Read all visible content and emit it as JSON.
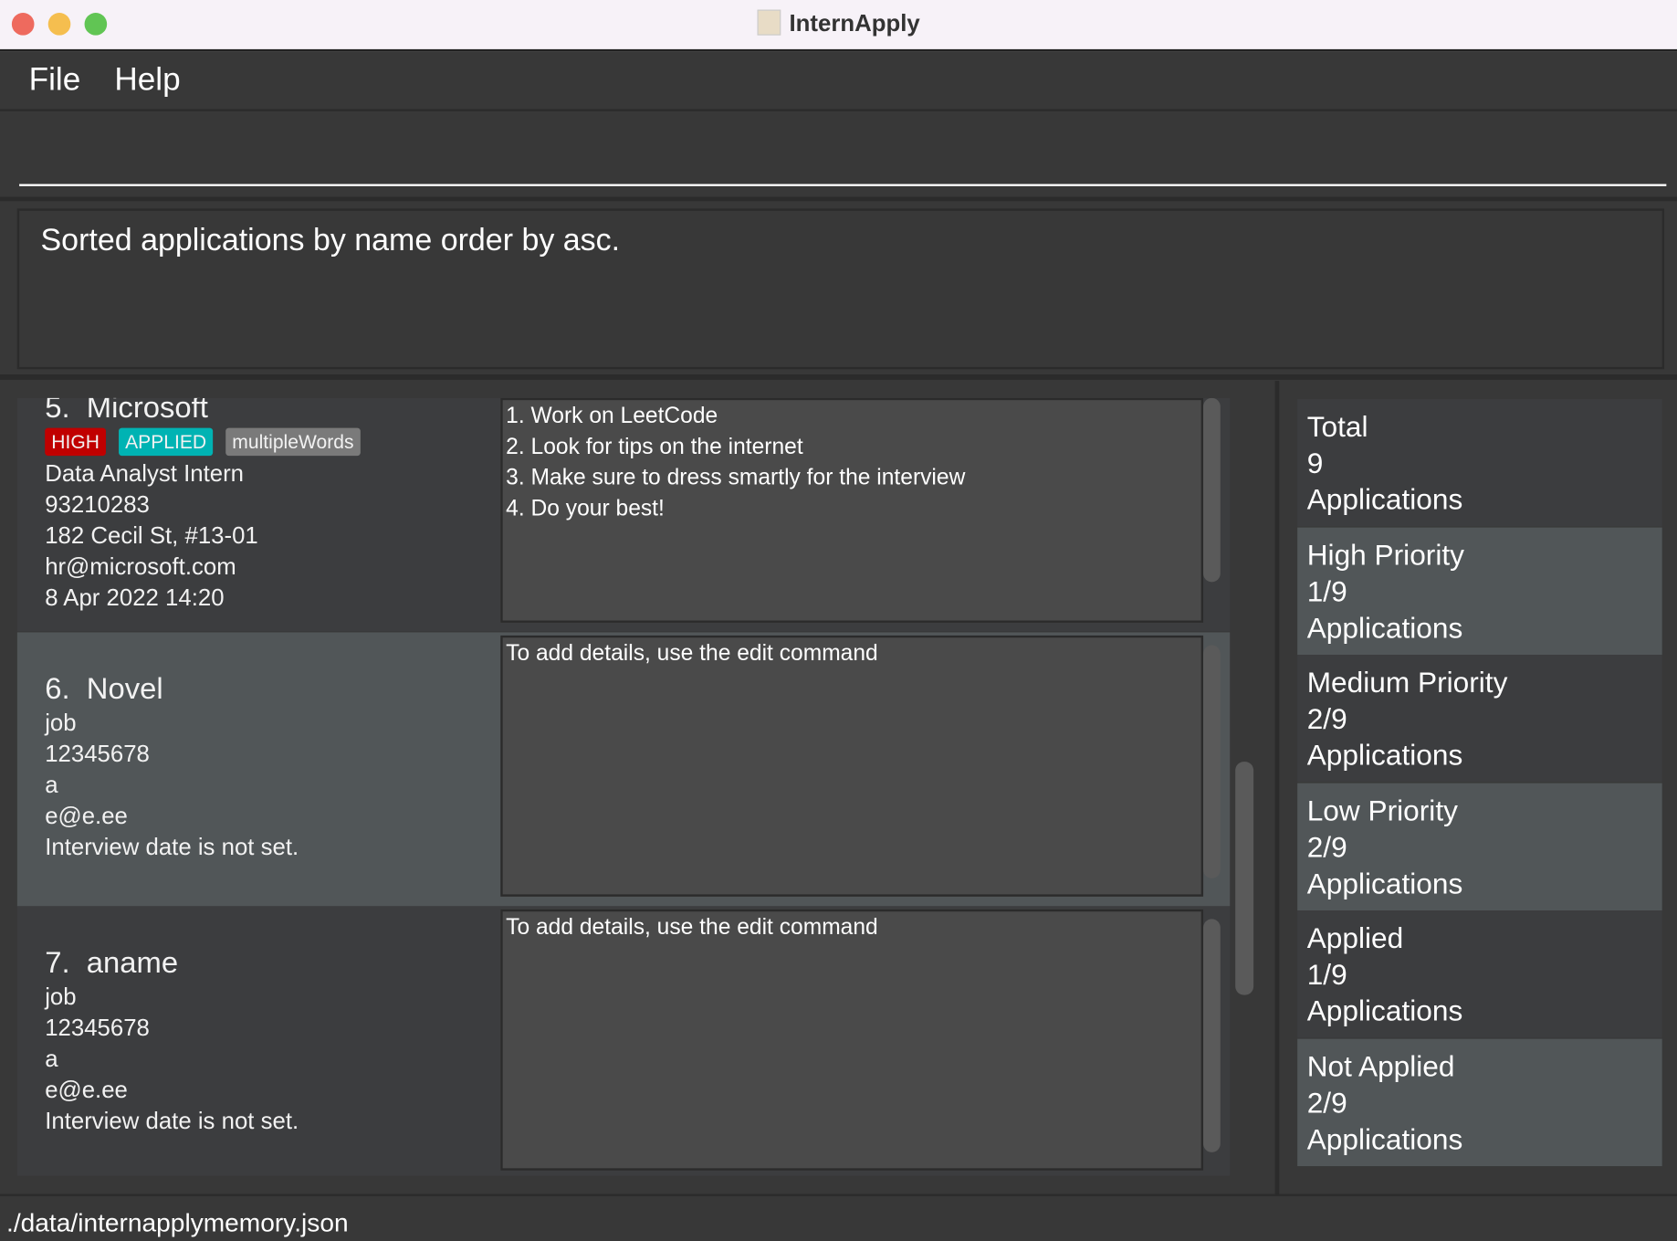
{
  "window": {
    "title": "InternApply"
  },
  "menu": {
    "file": "File",
    "help": "Help"
  },
  "command": {
    "value": "",
    "placeholder": ""
  },
  "result": {
    "message": "Sorted applications by name order by asc."
  },
  "colors": {
    "high": "#c00000",
    "applied": "#00b3b3",
    "tag": "#7a7a7a",
    "card_dark": "#3c3d3f",
    "card_light": "#515658"
  },
  "applications": [
    {
      "index": "5.",
      "name": "Microsoft",
      "tags": [
        {
          "label": "HIGH",
          "color": "#c00000"
        },
        {
          "label": "APPLIED",
          "color": "#00b3b3"
        },
        {
          "label": "multipleWords",
          "color": "#7a7a7a"
        }
      ],
      "job": "Data Analyst Intern",
      "phone": "93210283",
      "address": "182 Cecil St, #13-01",
      "email": "hr@microsoft.com",
      "interview": "8 Apr 2022 14:20",
      "details": [
        "1. Work on LeetCode",
        "2. Look for tips on the internet",
        "3. Make sure to dress smartly for the interview",
        "4. Do your best!"
      ]
    },
    {
      "index": "6.",
      "name": "Novel",
      "tags": [],
      "job": "job",
      "phone": "12345678",
      "address": "a",
      "email": "e@e.ee",
      "interview": "Interview date is not set.",
      "details": [
        "To add details, use the edit command"
      ]
    },
    {
      "index": "7.",
      "name": "aname",
      "tags": [],
      "job": "job",
      "phone": "12345678",
      "address": "a",
      "email": "e@e.ee",
      "interview": "Interview date is not set.",
      "details": [
        "To add details, use the edit command"
      ]
    }
  ],
  "stats": [
    {
      "title": "Total",
      "value": "9",
      "unit": "Applications"
    },
    {
      "title": "High Priority",
      "value": "1/9",
      "unit": "Applications"
    },
    {
      "title": "Medium Priority",
      "value": "2/9",
      "unit": "Applications"
    },
    {
      "title": "Low Priority",
      "value": "2/9",
      "unit": "Applications"
    },
    {
      "title": "Applied",
      "value": "1/9",
      "unit": "Applications"
    },
    {
      "title": "Not Applied",
      "value": "2/9",
      "unit": "Applications"
    }
  ],
  "status": {
    "path": "./data/internapplymemory.json"
  }
}
